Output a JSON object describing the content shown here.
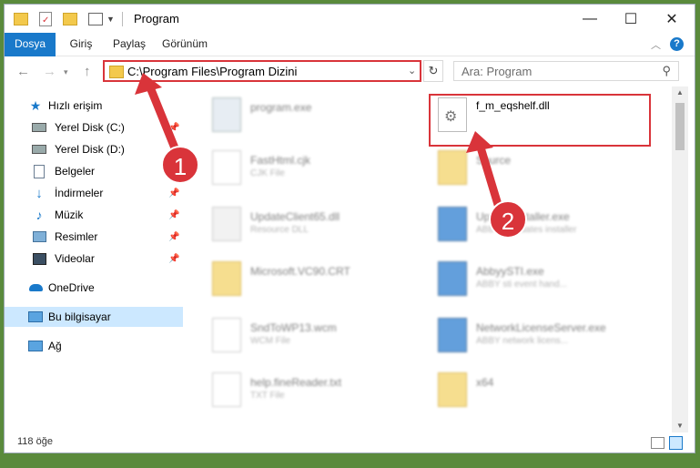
{
  "window": {
    "title": "Program",
    "controls": {
      "minimize": "—",
      "maximize": "☐",
      "close": "✕"
    }
  },
  "ribbon": {
    "tabs": [
      "Dosya",
      "Giriş",
      "Paylaş",
      "Görünüm"
    ],
    "accent": "#1979ca"
  },
  "address": {
    "path": "C:\\Program Files\\Program Dizini"
  },
  "search": {
    "placeholder": "Ara: Program"
  },
  "sidebar": {
    "items": [
      {
        "label": "Hızlı erişim",
        "icon": "star-icon"
      },
      {
        "label": "Yerel Disk (C:)",
        "icon": "drive-icon"
      },
      {
        "label": "Yerel Disk (D:)",
        "icon": "drive-icon"
      },
      {
        "label": "Belgeler",
        "icon": "document-icon"
      },
      {
        "label": "İndirmeler",
        "icon": "download-icon"
      },
      {
        "label": "Müzik",
        "icon": "music-icon"
      },
      {
        "label": "Resimler",
        "icon": "pictures-icon"
      },
      {
        "label": "Videolar",
        "icon": "video-icon"
      },
      {
        "label": "OneDrive",
        "icon": "cloud-icon"
      },
      {
        "label": "Bu bilgisayar",
        "icon": "computer-icon"
      },
      {
        "label": "Ağ",
        "icon": "network-icon"
      }
    ]
  },
  "files": {
    "col1": [
      {
        "name": "program.exe",
        "sub": ""
      },
      {
        "name": "FastHtml.cjk",
        "sub": "CJK File"
      },
      {
        "name": "UpdateClient65.dll",
        "sub": "Resource DLL"
      },
      {
        "name": "Microsoft.VC90.CRT",
        "sub": ""
      },
      {
        "name": "SndToWP13.wcm",
        "sub": "WCM File"
      },
      {
        "name": "help.fineReader.txt",
        "sub": "TXT File"
      }
    ],
    "col2": [
      {
        "name": "f_m_eqshelf.dll",
        "sub": ""
      },
      {
        "name": "Source",
        "sub": ""
      },
      {
        "name": "UpdateInstaller.exe",
        "sub": "ABBYY Updates installer"
      },
      {
        "name": "AbbyySTI.exe",
        "sub": "ABBY sti event hand..."
      },
      {
        "name": "NetworkLicenseServer.exe",
        "sub": "ABBY network licens..."
      },
      {
        "name": "x64",
        "sub": ""
      }
    ]
  },
  "status": {
    "count": "118 öğe"
  },
  "annotations": {
    "step1": "1",
    "step2": "2",
    "color": "#d9343a"
  }
}
